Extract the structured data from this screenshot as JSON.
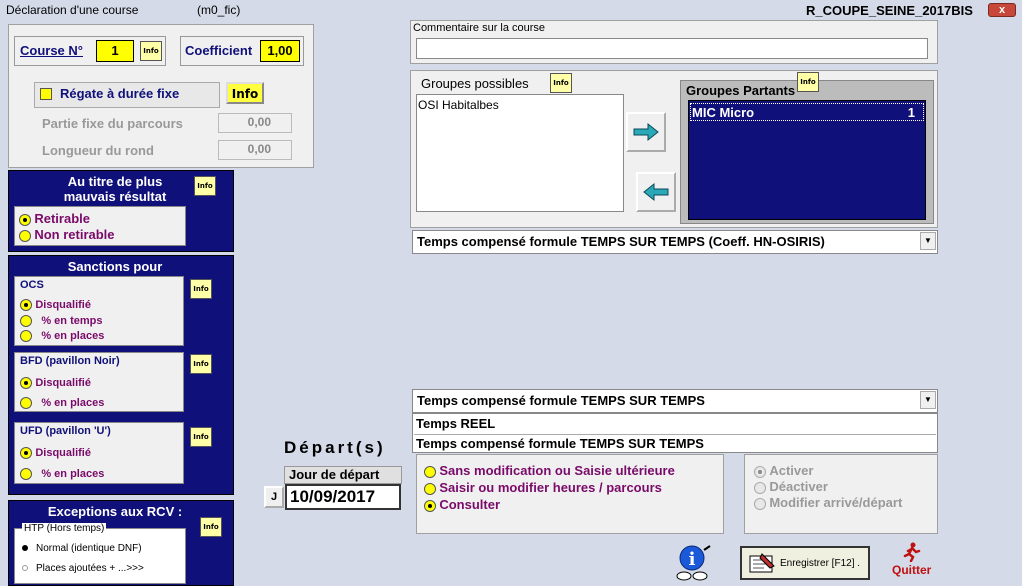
{
  "window": {
    "title": "Déclaration d'une course",
    "subtitle": "(m0_fic)",
    "name": "R_COUPE_SEINE_2017BIS",
    "close": "x"
  },
  "course": {
    "label": "Course N°",
    "value": "1",
    "coef_label": "Coefficient",
    "coef_value": "1,00"
  },
  "regate": {
    "label": "Régate à durée fixe",
    "info": "Info",
    "partie_label": "Partie fixe du parcours",
    "partie_value": "0,00",
    "longueur_label": "Longueur du rond",
    "longueur_value": "0,00"
  },
  "mauvais": {
    "title_line1": "Au titre de plus",
    "title_line2": "mauvais résultat",
    "options": [
      "Retirable",
      "Non retirable"
    ]
  },
  "sanctions": {
    "title": "Sanctions pour",
    "ocs": {
      "title": "OCS",
      "options": [
        "Disqualifié",
        "% en  temps",
        "% en places"
      ]
    },
    "bfd": {
      "title": "BFD (pavillon Noir)",
      "options": [
        "Disqualifié",
        "% en places"
      ]
    },
    "ufd": {
      "title": "UFD (pavillon 'U')",
      "options": [
        "Disqualifié",
        "% en places"
      ]
    }
  },
  "exceptions": {
    "title": "Exceptions aux RCV :",
    "group": "HTP (Hors temps)",
    "options": [
      "Normal (identique DNF)",
      "Places ajoutées + ...>>>"
    ]
  },
  "commentaire": {
    "label": "Commentaire sur la course",
    "value": ""
  },
  "groupes_possibles": {
    "label": "Groupes possibles",
    "items": [
      "OSI Habitalbes"
    ]
  },
  "groupes_partants": {
    "label": "Groupes Partants",
    "items": [
      {
        "name": "MIC Micro",
        "count": "1"
      }
    ]
  },
  "formule1": {
    "value": "Temps compensé formule TEMPS SUR TEMPS (Coeff. HN-OSIRIS)"
  },
  "formule2": {
    "value": "Temps compensé formule TEMPS SUR TEMPS",
    "options": [
      "Temps REEL",
      "Temps compensé formule TEMPS SUR TEMPS"
    ]
  },
  "depart": {
    "title": "Départ(s)",
    "jour_label": "Jour de départ",
    "j_button": "J",
    "date": "10/09/2017"
  },
  "mode": {
    "options": [
      "Sans modification ou Saisie ultérieure",
      "Saisir ou modifier heures / parcours",
      "Consulter"
    ]
  },
  "activation": {
    "options": [
      "Activer",
      "Déactiver",
      "Modifier arrivé/départ"
    ]
  },
  "footer": {
    "save": "Enregistrer [F12] .",
    "quit": "Quitter"
  },
  "colors": {
    "navy": "#10107a",
    "yellow": "#ffff00",
    "purple": "#7a0a6a",
    "background": "#d4dae7"
  }
}
